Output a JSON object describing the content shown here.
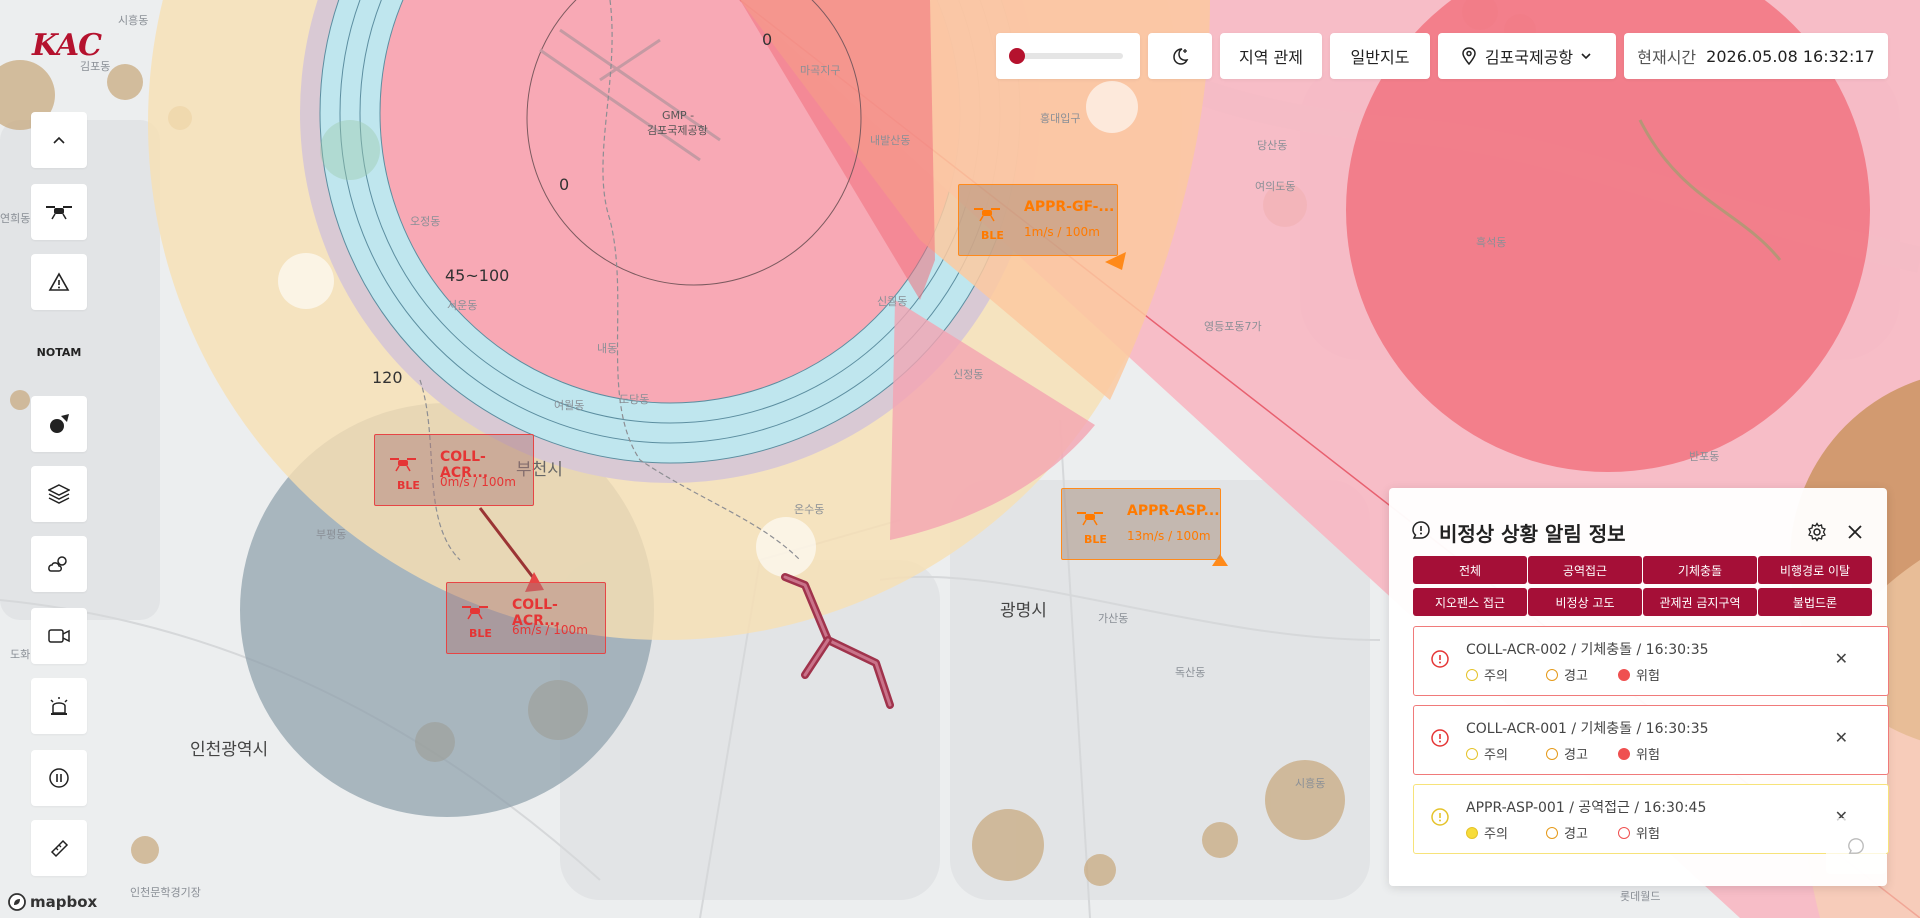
{
  "logo": "KAC",
  "topbar": {
    "theme_toggle": "moon-plus",
    "region_control": "지역 관제",
    "basemap": "일반지도",
    "airport": "김포국제공항",
    "time_label": "현재시간",
    "time_value": "2026.05.08 16:32:17"
  },
  "left_toolbar": {
    "notam": "NOTAM"
  },
  "map_labels": {
    "zone_0_top": "0",
    "zone_0_center": "0",
    "zone_45_100": "45~100",
    "zone_120": "120",
    "gmp_1": "GMP -",
    "gmp_2": "김포국제공항",
    "bucheon": "부천시",
    "gwangmyeong": "광명시",
    "incheon": "인천광역시",
    "s1": "시흥동",
    "s2": "김포동",
    "s3": "연희동",
    "s4": "오정동",
    "s5": "서운동",
    "s6": "내동",
    "s7": "도당동",
    "s8": "여월동",
    "s9": "신월동",
    "s10": "신정동",
    "s11": "온수동",
    "s12": "부평동",
    "s13": "가산동",
    "s14": "독산동",
    "s15": "시흥동",
    "s16": "영등포동7가",
    "s17": "당산동",
    "s18": "흑석동",
    "s19": "반포동",
    "s20": "인천문학경기장",
    "s21": "롯데월드",
    "s22": "도화",
    "s23": "마곡지구",
    "s24": "내발산동",
    "s25": "홍대입구",
    "s26": "여의도동"
  },
  "drones": [
    {
      "name": "APPR-GF-...",
      "ble": "BLE",
      "speed": "1m/s / 100m"
    },
    {
      "name": "COLL-ACR...",
      "ble": "BLE",
      "speed": "0m/s / 100m"
    },
    {
      "name": "COLL-ACR...",
      "ble": "BLE",
      "speed": "6m/s / 100m"
    },
    {
      "name": "APPR-ASP...",
      "ble": "BLE",
      "speed": "13m/s / 100m"
    }
  ],
  "panel": {
    "title": "비정상 상황 알림 정보",
    "categories": [
      "전체",
      "공역접근",
      "기체충돌",
      "비행경로 이탈",
      "지오펜스 접근",
      "비정상 고도",
      "관제권 금지구역",
      "불법드론"
    ],
    "alerts": [
      {
        "text": "COLL-ACR-002  /  기체충돌  /  16:30:35",
        "levels": [
          "주의",
          "경고",
          "위험"
        ],
        "active": 2
      },
      {
        "text": "COLL-ACR-001  /  기체충돌  /  16:30:35",
        "levels": [
          "주의",
          "경고",
          "위험"
        ],
        "active": 2
      },
      {
        "text": "APPR-ASP-001  /  공역접근  /  16:30:45",
        "levels": [
          "주의",
          "경고",
          "위험"
        ],
        "active": 0
      }
    ],
    "close": "✕"
  },
  "attribution": "mapbox",
  "colors": {
    "accent": "#a50f37",
    "danger": "#ef4444",
    "warn": "#f59e0b",
    "caution": "#facc15"
  }
}
